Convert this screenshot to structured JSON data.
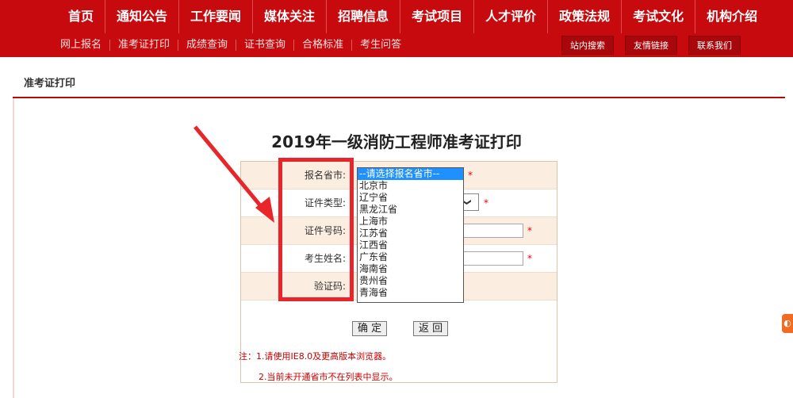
{
  "top_nav": [
    "首页",
    "通知公告",
    "工作要闻",
    "媒体关注",
    "招聘信息",
    "考试项目",
    "人才评价",
    "政策法规",
    "考试文化",
    "机构介绍"
  ],
  "sub_nav": [
    "网上报名",
    "准考证打印",
    "成绩查询",
    "证书查询",
    "合格标准",
    "考生问答"
  ],
  "sub_buttons": [
    "站内搜索",
    "友情链接",
    "联系我们"
  ],
  "breadcrumb": "准考证打印",
  "page_title": "2019年一级消防工程师准考证打印",
  "form": {
    "province_label": "报名省市:",
    "id_type_label": "证件类型:",
    "id_number_label": "证件号码:",
    "name_label": "考生姓名:",
    "captcha_label": "验证码:",
    "required_mark": "*",
    "id_type_arrow": "❯",
    "submit_label": "确 定",
    "back_label": "返 回"
  },
  "dropdown_options": [
    "--请选择报名省市--",
    "北京市",
    "辽宁省",
    "黑龙江省",
    "上海市",
    "江苏省",
    "江西省",
    "广东省",
    "海南省",
    "贵州省",
    "青海省"
  ],
  "notes": [
    "注：1.请使用IE8.0及更高版本浏览器。",
    "2.当前未开通省市不在列表中显示。"
  ],
  "colors": {
    "brand_red": "#c60a0e",
    "annotation_red": "#e8252a",
    "row_shade": "#fbeee0",
    "select_highlight": "#1e90ff"
  }
}
